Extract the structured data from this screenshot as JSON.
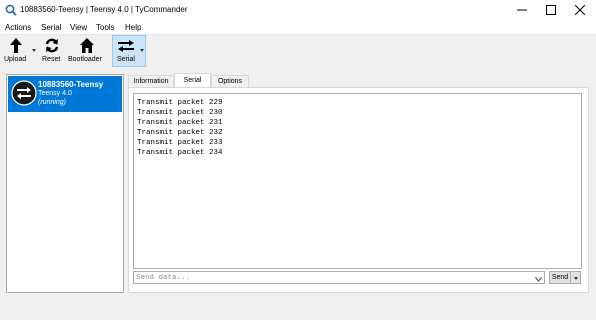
{
  "window": {
    "title": "10883560-Teensy | Teensy 4.0 | TyCommander"
  },
  "menu": {
    "items": [
      "Actions",
      "Serial",
      "View",
      "Tools",
      "Help"
    ]
  },
  "toolbar": {
    "upload_label": "Upload",
    "reset_label": "Reset",
    "bootloader_label": "Bootloader",
    "serial_label": "Serial"
  },
  "device": {
    "name": "10883560-Teensy",
    "model": "Teensy 4.0",
    "status": "(running)"
  },
  "tabs": {
    "information": "Information",
    "serial": "Serial",
    "options": "Options",
    "active": "Serial"
  },
  "serial": {
    "lines": [
      "Transmit packet 229",
      "Transmit packet 230",
      "Transmit packet 231",
      "Transmit packet 232",
      "Transmit packet 233",
      "Transmit packet 234"
    ],
    "input_value": "",
    "input_placeholder": "Send data...",
    "send_label": "Send"
  },
  "colors": {
    "selection": "#0078d7",
    "toolbar_active": "#cce4f7"
  }
}
